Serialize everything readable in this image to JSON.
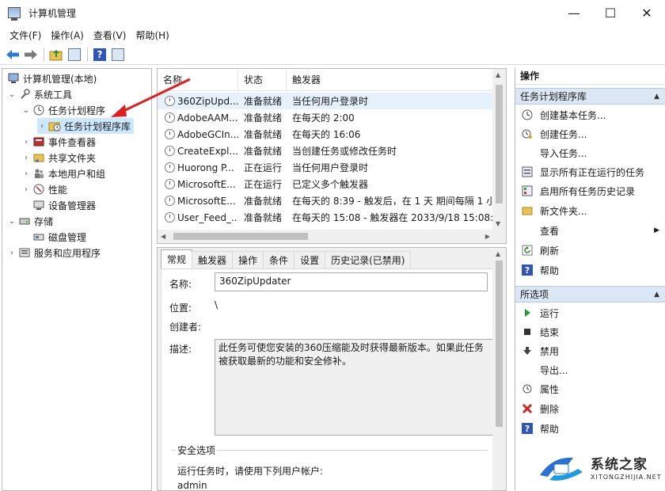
{
  "window": {
    "title": "计算机管理",
    "minimize": "—",
    "maximize": "☐",
    "close": "✕"
  },
  "menu": [
    "文件(F)",
    "操作(A)",
    "查看(V)",
    "帮助(H)"
  ],
  "toolbar": {
    "icons": [
      "back-arrow-icon",
      "forward-arrow-icon",
      "up-folder-icon",
      "show-hide-tree-icon",
      "help-icon",
      "show-action-pane-icon"
    ],
    "help_glyph": "?"
  },
  "tree": {
    "items": [
      {
        "label": "计算机管理(本地)",
        "icon": "computer-management-icon",
        "level": 0,
        "chevron": ""
      },
      {
        "label": "系统工具",
        "icon": "system-tools-icon",
        "level": 1,
        "chevron": "expanded"
      },
      {
        "label": "任务计划程序",
        "icon": "clock-icon",
        "level": 2,
        "chevron": "expanded"
      },
      {
        "label": "任务计划程序库",
        "icon": "folder-clock-icon",
        "level": 3,
        "chevron": "collapsed",
        "selected": true
      },
      {
        "label": "事件查看器",
        "icon": "event-viewer-icon",
        "level": 2,
        "chevron": "collapsed"
      },
      {
        "label": "共享文件夹",
        "icon": "shared-folder-icon",
        "level": 2,
        "chevron": "collapsed"
      },
      {
        "label": "本地用户和组",
        "icon": "users-icon",
        "level": 2,
        "chevron": "collapsed"
      },
      {
        "label": "性能",
        "icon": "performance-icon",
        "level": 2,
        "chevron": "collapsed"
      },
      {
        "label": "设备管理器",
        "icon": "device-manager-icon",
        "level": 2,
        "chevron": ""
      },
      {
        "label": "存储",
        "icon": "storage-icon",
        "level": 1,
        "chevron": "expanded"
      },
      {
        "label": "磁盘管理",
        "icon": "disk-management-icon",
        "level": 2,
        "chevron": ""
      },
      {
        "label": "服务和应用程序",
        "icon": "services-icon",
        "level": 1,
        "chevron": "collapsed"
      }
    ]
  },
  "task_list": {
    "columns": [
      "名称",
      "状态",
      "触发器"
    ],
    "rows": [
      {
        "name": "360ZipUpd...",
        "status": "准备就绪",
        "trigger": "当任何用户登录时"
      },
      {
        "name": "AdobeAAM...",
        "status": "准备就绪",
        "trigger": "在每天的 2:00"
      },
      {
        "name": "AdobeGCIn...",
        "status": "准备就绪",
        "trigger": "在每天的 16:06"
      },
      {
        "name": "CreateExpl...",
        "status": "准备就绪",
        "trigger": "当创建任务或修改任务时"
      },
      {
        "name": "Huorong P...",
        "status": "正在运行",
        "trigger": "当任何用户登录时"
      },
      {
        "name": "MicrosoftE...",
        "status": "正在运行",
        "trigger": "已定义多个触发器"
      },
      {
        "name": "MicrosoftE...",
        "status": "准备就绪",
        "trigger": "在每天的 8:39 - 触发后，在 1 天 期间每隔 1 小"
      },
      {
        "name": "User_Feed_...",
        "status": "准备就绪",
        "trigger": "在每天的 15:08 - 触发器在 2033/9/18 15:08:5"
      }
    ]
  },
  "detail": {
    "tabs": [
      "常规",
      "触发器",
      "操作",
      "条件",
      "设置",
      "历史记录(已禁用)"
    ],
    "name_label": "名称:",
    "name_value": "360ZipUpdater",
    "location_label": "位置:",
    "location_value": "\\",
    "author_label": "创建者:",
    "author_value": "",
    "description_label": "描述:",
    "description_value": "此任务可使您安装的360压缩能及时获得最新版本。如果此任务被获取最新的功能和安全修补。",
    "security_group": "安全选项",
    "run_as_label": "运行任务时，请使用下列用户帐户:",
    "run_as_value": "admin"
  },
  "actions": {
    "header": "操作",
    "section1_title": "任务计划程序库",
    "section1_items": [
      {
        "label": "创建基本任务...",
        "icon": "create-basic-task-icon"
      },
      {
        "label": "创建任务...",
        "icon": "create-task-icon"
      },
      {
        "label": "导入任务...",
        "icon": ""
      },
      {
        "label": "显示所有正在运行的任务",
        "icon": "running-tasks-icon"
      },
      {
        "label": "启用所有任务历史记录",
        "icon": "task-history-icon"
      },
      {
        "label": "新文件夹...",
        "icon": "new-folder-icon"
      },
      {
        "label": "查看",
        "icon": "",
        "submenu": true
      },
      {
        "label": "刷新",
        "icon": "refresh-icon"
      },
      {
        "label": "帮助",
        "icon": "help-icon"
      }
    ],
    "section2_title": "所选项",
    "section2_items": [
      {
        "label": "运行",
        "icon": "run-icon"
      },
      {
        "label": "结束",
        "icon": "stop-icon"
      },
      {
        "label": "禁用",
        "icon": "disable-icon"
      },
      {
        "label": "导出...",
        "icon": ""
      },
      {
        "label": "属性",
        "icon": "properties-icon"
      },
      {
        "label": "删除",
        "icon": "delete-icon"
      },
      {
        "label": "帮助",
        "icon": "help-icon"
      }
    ]
  },
  "watermark": {
    "title": "系统之家",
    "subtitle": "XITONGZHIJIA.NET"
  },
  "colors": {
    "selection": "#cce8ff",
    "row_selection": "#e5f1fb",
    "section_header": "#dce7f5",
    "annotation_arrow": "#e02020"
  }
}
